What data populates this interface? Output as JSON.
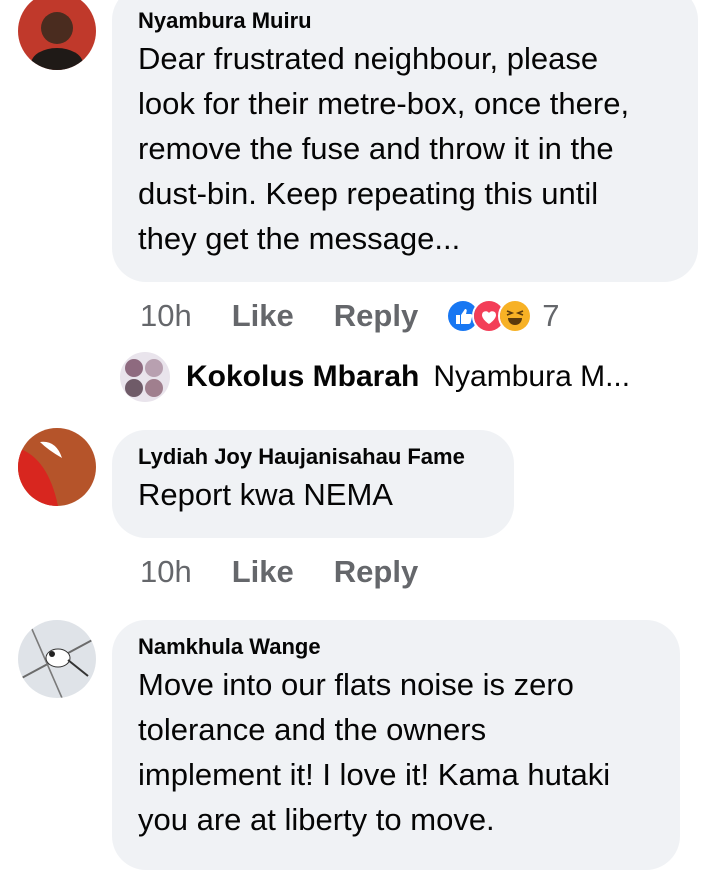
{
  "comments": [
    {
      "author": "Nyambura Muiru",
      "lines": [
        "Dear frustrated neighbour, please",
        "look for their metre-box, once there,",
        "remove the fuse and throw it in the",
        "dust-bin. Keep repeating this until",
        "they get the message..."
      ],
      "time": "10h",
      "like_label": "Like",
      "reply_label": "Reply",
      "reactions": [
        "like-icon",
        "love-icon",
        "haha-icon"
      ],
      "reaction_count": "7"
    },
    {
      "author": "Lydiah Joy Haujanisahau Fame",
      "lines": [
        "Report kwa NEMA"
      ],
      "time": "10h",
      "like_label": "Like",
      "reply_label": "Reply"
    },
    {
      "author": "Namkhula Wange",
      "lines": [
        "Move into our flats noise is zero",
        "tolerance and the owners",
        "implement it! I love it! Kama hutaki",
        "you are at liberty to move."
      ]
    }
  ],
  "reply_preview": {
    "author": "Kokolus Mbarah",
    "text": "Nyambura M..."
  },
  "colors": {
    "bubble": "#f0f2f5",
    "secondary_text": "#65676b",
    "like_blue": "#1877f2",
    "love_red": "#f33e58",
    "haha_yellow": "#f7b125"
  }
}
